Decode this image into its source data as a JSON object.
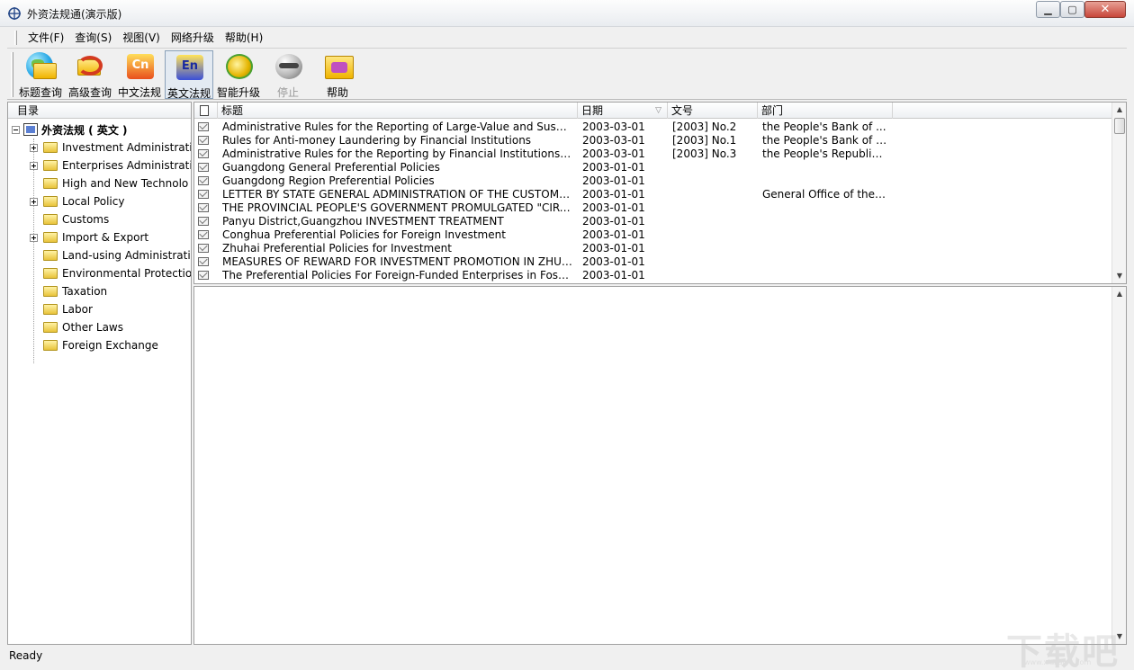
{
  "window": {
    "title": "外资法规通(演示版)",
    "min_glyph": "▁",
    "max_glyph": "▢",
    "close_glyph": "✕"
  },
  "menu": [
    {
      "label": "文件(F)"
    },
    {
      "label": "查询(S)"
    },
    {
      "label": "视图(V)"
    },
    {
      "label": "网络升级"
    },
    {
      "label": "帮助(H)"
    }
  ],
  "toolbar": [
    {
      "label": "标题查询",
      "icon": "globe-folder-icon",
      "enabled": true
    },
    {
      "label": "高级查询",
      "icon": "folder-arrow-icon",
      "enabled": true
    },
    {
      "label": "中文法规",
      "icon": "cn-law-icon",
      "badge": "Cn",
      "enabled": true
    },
    {
      "label": "英文法规",
      "icon": "en-law-icon",
      "badge": "En",
      "enabled": true,
      "pressed": true
    },
    {
      "label": "智能升级",
      "icon": "upgrade-globe-icon",
      "enabled": true
    },
    {
      "label": "停止",
      "icon": "stop-icon",
      "enabled": false
    },
    {
      "label": "帮助",
      "icon": "help-folder-icon",
      "enabled": true
    }
  ],
  "tree": {
    "header": "目录",
    "root": "外资法规 ( 英文 )",
    "items": [
      {
        "label": "Investment Administratio",
        "expandable": true
      },
      {
        "label": "Enterprises Administratio",
        "expandable": true
      },
      {
        "label": "High and New Technolo",
        "expandable": false
      },
      {
        "label": "Local Policy",
        "expandable": true
      },
      {
        "label": "Customs",
        "expandable": false
      },
      {
        "label": "Import & Export",
        "expandable": true
      },
      {
        "label": "Land-using Administratic",
        "expandable": false
      },
      {
        "label": "Environmental Protection",
        "expandable": false
      },
      {
        "label": "Taxation",
        "expandable": false
      },
      {
        "label": "Labor",
        "expandable": false
      },
      {
        "label": "Other Laws",
        "expandable": false
      },
      {
        "label": "Foreign Exchange",
        "expandable": false
      }
    ]
  },
  "list": {
    "columns": {
      "title": "标题",
      "date": "日期",
      "doc_no": "文号",
      "dept": "部门",
      "sort_indicator": "▽"
    },
    "rows": [
      {
        "title": "Administrative Rules for the Reporting of Large-Value and Suspicious...",
        "date": "2003-03-01",
        "doc_no": "[2003] No.2",
        "dept": " the People's Bank of ..."
      },
      {
        "title": "Rules for Anti-money Laundering by Financial Institutions",
        "date": "2003-03-01",
        "doc_no": "[2003] No.1",
        "dept": "the People's Bank of C..."
      },
      {
        "title": "Administrative Rules for the Reporting by Financial Institutions of Lar...",
        "date": "2003-03-01",
        "doc_no": "[2003] No.3",
        "dept": "the People's Republic ..."
      },
      {
        "title": "Guangdong General Preferential Policies",
        "date": "2003-01-01",
        "doc_no": "",
        "dept": ""
      },
      {
        "title": "Guangdong Region Preferential Policies",
        "date": "2003-01-01",
        "doc_no": "",
        "dept": ""
      },
      {
        "title": "LETTER BY STATE GENERAL ADMINISTRATION OF THE CUSTOMS ...",
        "date": "2003-01-01",
        "doc_no": "",
        "dept": "General Office of the P..."
      },
      {
        "title": "THE PROVINCIAL PEOPLE'S GOVERNMENT PROMULGATED \"CIRCUL...",
        "date": "2003-01-01",
        "doc_no": "",
        "dept": ""
      },
      {
        "title": "Panyu District,Guangzhou INVESTMENT TREATMENT",
        "date": "2003-01-01",
        "doc_no": "",
        "dept": ""
      },
      {
        "title": "Conghua Preferential Policies for Foreign Investment",
        "date": "2003-01-01",
        "doc_no": "",
        "dept": ""
      },
      {
        "title": "Zhuhai Preferential Policies for Investment",
        "date": "2003-01-01",
        "doc_no": "",
        "dept": ""
      },
      {
        "title": "MEASURES OF REWARD FOR INVESTMENT PROMOTION IN ZHUHAI...",
        "date": "2003-01-01",
        "doc_no": "",
        "dept": ""
      },
      {
        "title": "The Preferential Policies For Foreign-Funded Enterprises in Foshan",
        "date": "2003-01-01",
        "doc_no": "",
        "dept": ""
      }
    ]
  },
  "scroll": {
    "up": "▲",
    "down": "▼"
  },
  "status": "Ready",
  "watermark": {
    "text": "下载吧",
    "url": "www.xiazaiba.com"
  }
}
